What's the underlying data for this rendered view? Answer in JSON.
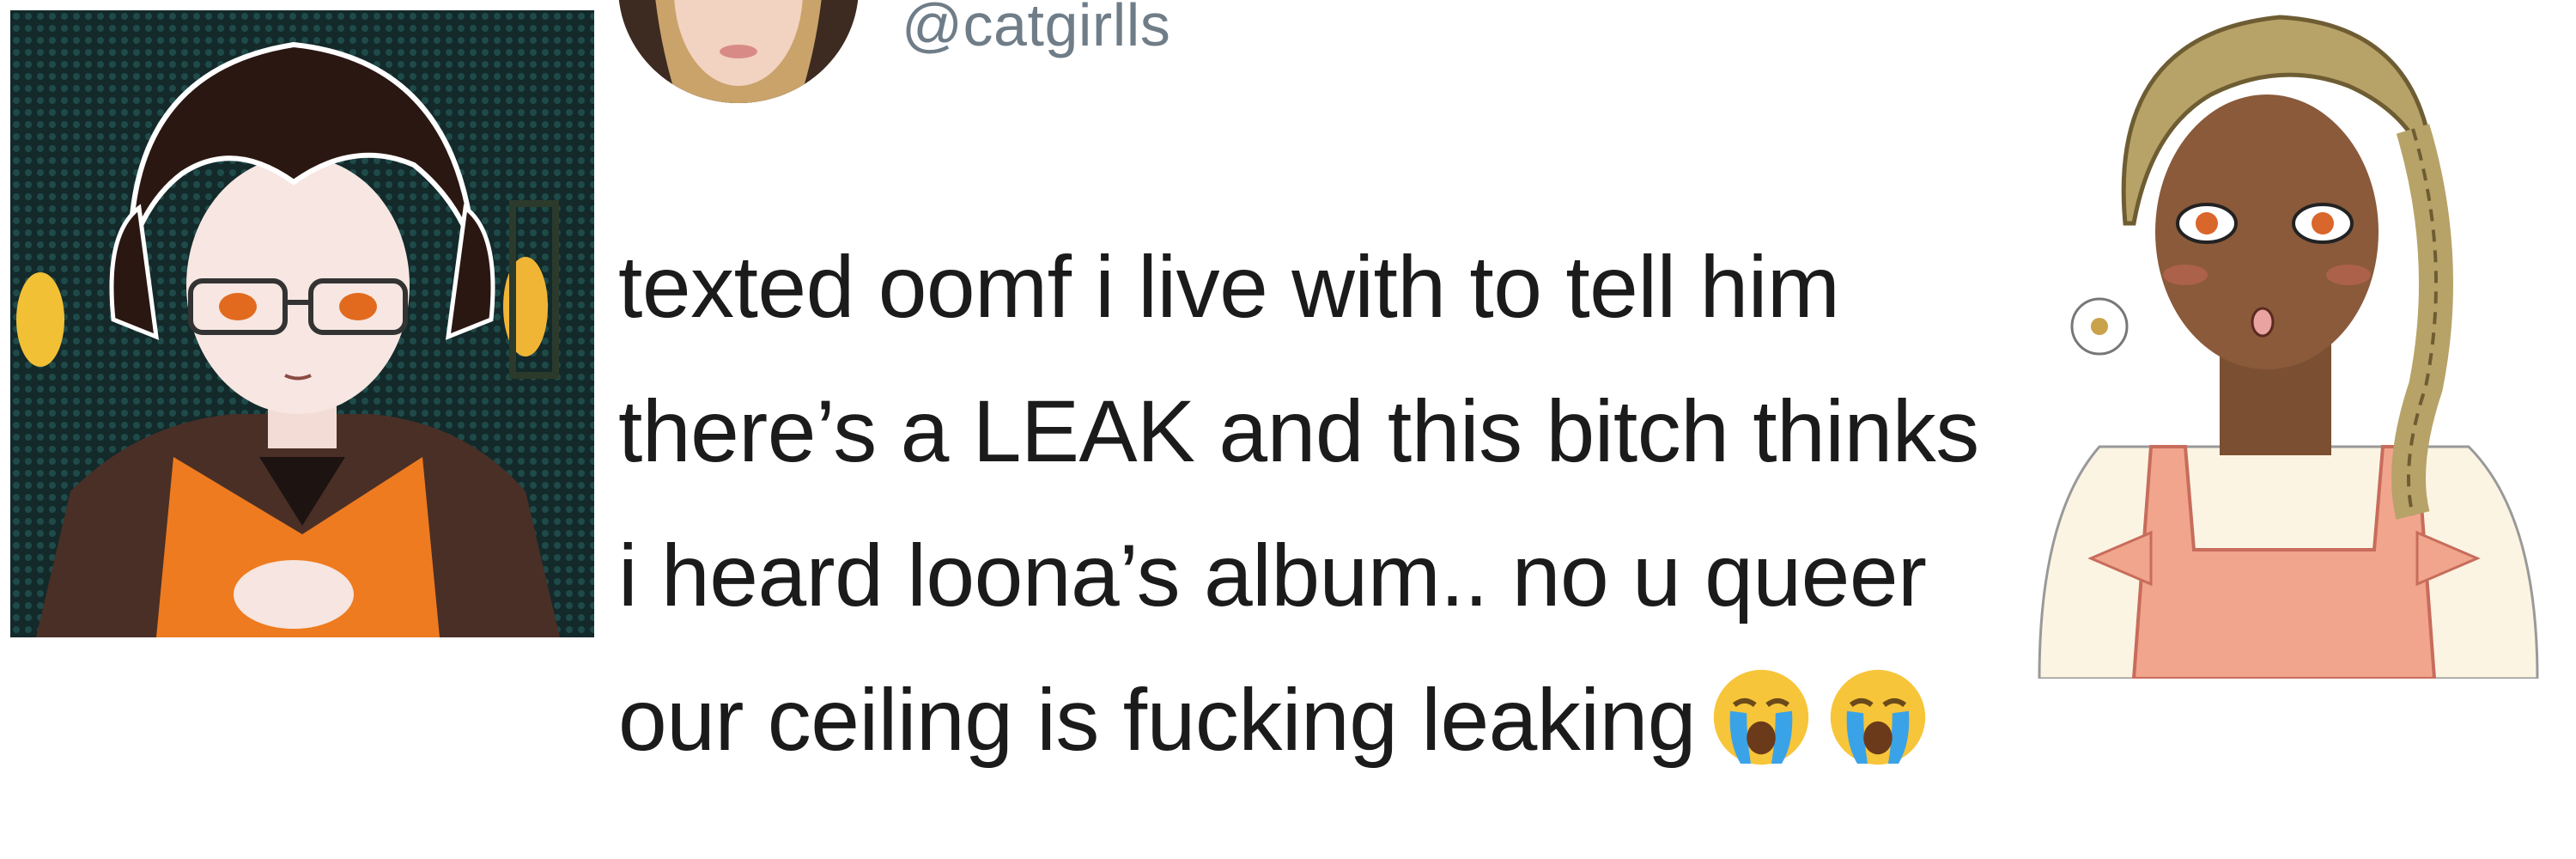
{
  "tweet": {
    "handle": "@catgirlls",
    "lines": [
      "texted oomf i live with to tell him",
      "there’s a LEAK and this bitch thinks",
      "i heard loona’s album.. no u queer",
      "our ceiling is fucking leaking"
    ],
    "emojis": [
      "loudly-crying-face",
      "loudly-crying-face"
    ]
  },
  "images": {
    "left": "anime-character-with-glasses-portrait",
    "right": "girl-with-braids-in-overalls-portrait",
    "avatar": "profile-avatar-photo"
  },
  "colors": {
    "handle": "#6f7d88",
    "text": "#1b1b1b",
    "background": "#ffffff"
  }
}
